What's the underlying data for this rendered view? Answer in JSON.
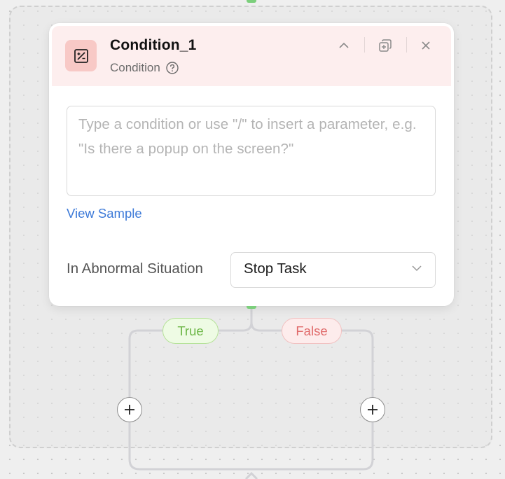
{
  "node": {
    "title": "Condition_1",
    "type_label": "Condition",
    "icon": "condition-icon",
    "header_color": "#fdeeee",
    "icon_bg_color": "#f8c9c6"
  },
  "header_actions": {
    "collapse_icon": "chevron-up-icon",
    "duplicate_icon": "duplicate-icon",
    "close_icon": "close-icon"
  },
  "condition_input": {
    "value": "",
    "placeholder": "Type a condition or use \"/\" to insert a parameter, e.g. \"Is there a popup on the screen?\""
  },
  "view_sample_label": "View Sample",
  "abnormal": {
    "label": "In Abnormal Situation",
    "selected": "Stop Task"
  },
  "branches": {
    "true_label": "True",
    "false_label": "False",
    "true_color": "#6cb646",
    "false_color": "#e06a6a"
  },
  "connector_color": "#7ccf7c",
  "link_color": "#3d7ad8"
}
